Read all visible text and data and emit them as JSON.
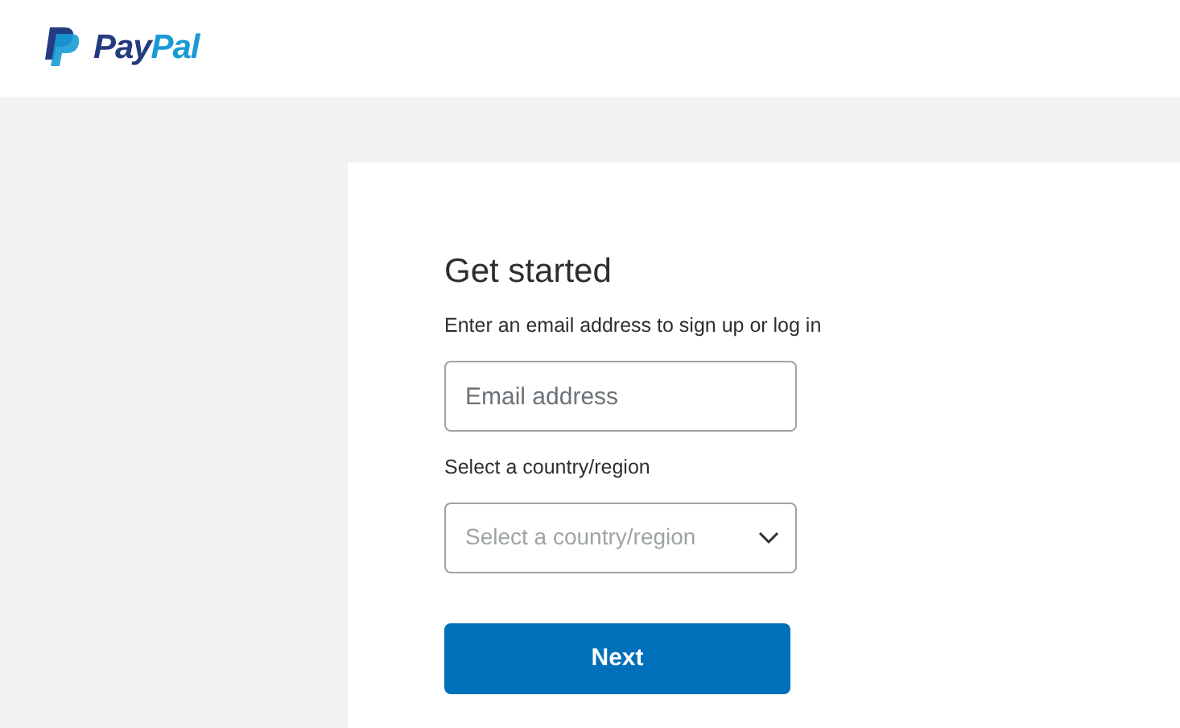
{
  "header": {
    "logo_text": [
      "Pay",
      "Pal"
    ]
  },
  "form": {
    "title": "Get started",
    "subtitle": "Enter an email address to sign up or log in",
    "email": {
      "placeholder": "Email address"
    },
    "country_label": "Select a country/region",
    "country": {
      "placeholder": "Select a country/region"
    },
    "button": "Next"
  }
}
